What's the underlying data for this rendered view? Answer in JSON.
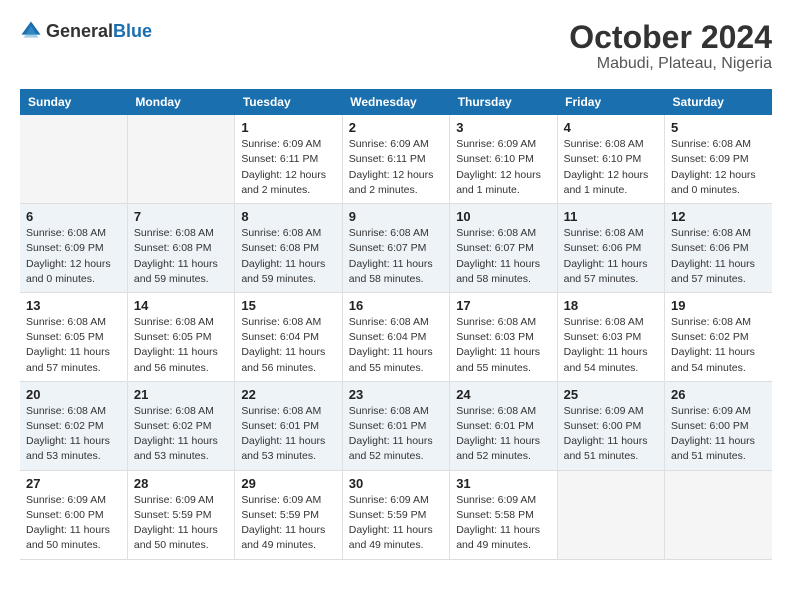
{
  "logo": {
    "general": "General",
    "blue": "Blue"
  },
  "title": "October 2024",
  "subtitle": "Mabudi, Plateau, Nigeria",
  "days_of_week": [
    "Sunday",
    "Monday",
    "Tuesday",
    "Wednesday",
    "Thursday",
    "Friday",
    "Saturday"
  ],
  "weeks": [
    [
      {
        "day": "",
        "info": ""
      },
      {
        "day": "",
        "info": ""
      },
      {
        "day": "1",
        "info": "Sunrise: 6:09 AM\nSunset: 6:11 PM\nDaylight: 12 hours\nand 2 minutes."
      },
      {
        "day": "2",
        "info": "Sunrise: 6:09 AM\nSunset: 6:11 PM\nDaylight: 12 hours\nand 2 minutes."
      },
      {
        "day": "3",
        "info": "Sunrise: 6:09 AM\nSunset: 6:10 PM\nDaylight: 12 hours\nand 1 minute."
      },
      {
        "day": "4",
        "info": "Sunrise: 6:08 AM\nSunset: 6:10 PM\nDaylight: 12 hours\nand 1 minute."
      },
      {
        "day": "5",
        "info": "Sunrise: 6:08 AM\nSunset: 6:09 PM\nDaylight: 12 hours\nand 0 minutes."
      }
    ],
    [
      {
        "day": "6",
        "info": "Sunrise: 6:08 AM\nSunset: 6:09 PM\nDaylight: 12 hours\nand 0 minutes."
      },
      {
        "day": "7",
        "info": "Sunrise: 6:08 AM\nSunset: 6:08 PM\nDaylight: 11 hours\nand 59 minutes."
      },
      {
        "day": "8",
        "info": "Sunrise: 6:08 AM\nSunset: 6:08 PM\nDaylight: 11 hours\nand 59 minutes."
      },
      {
        "day": "9",
        "info": "Sunrise: 6:08 AM\nSunset: 6:07 PM\nDaylight: 11 hours\nand 58 minutes."
      },
      {
        "day": "10",
        "info": "Sunrise: 6:08 AM\nSunset: 6:07 PM\nDaylight: 11 hours\nand 58 minutes."
      },
      {
        "day": "11",
        "info": "Sunrise: 6:08 AM\nSunset: 6:06 PM\nDaylight: 11 hours\nand 57 minutes."
      },
      {
        "day": "12",
        "info": "Sunrise: 6:08 AM\nSunset: 6:06 PM\nDaylight: 11 hours\nand 57 minutes."
      }
    ],
    [
      {
        "day": "13",
        "info": "Sunrise: 6:08 AM\nSunset: 6:05 PM\nDaylight: 11 hours\nand 57 minutes."
      },
      {
        "day": "14",
        "info": "Sunrise: 6:08 AM\nSunset: 6:05 PM\nDaylight: 11 hours\nand 56 minutes."
      },
      {
        "day": "15",
        "info": "Sunrise: 6:08 AM\nSunset: 6:04 PM\nDaylight: 11 hours\nand 56 minutes."
      },
      {
        "day": "16",
        "info": "Sunrise: 6:08 AM\nSunset: 6:04 PM\nDaylight: 11 hours\nand 55 minutes."
      },
      {
        "day": "17",
        "info": "Sunrise: 6:08 AM\nSunset: 6:03 PM\nDaylight: 11 hours\nand 55 minutes."
      },
      {
        "day": "18",
        "info": "Sunrise: 6:08 AM\nSunset: 6:03 PM\nDaylight: 11 hours\nand 54 minutes."
      },
      {
        "day": "19",
        "info": "Sunrise: 6:08 AM\nSunset: 6:02 PM\nDaylight: 11 hours\nand 54 minutes."
      }
    ],
    [
      {
        "day": "20",
        "info": "Sunrise: 6:08 AM\nSunset: 6:02 PM\nDaylight: 11 hours\nand 53 minutes."
      },
      {
        "day": "21",
        "info": "Sunrise: 6:08 AM\nSunset: 6:02 PM\nDaylight: 11 hours\nand 53 minutes."
      },
      {
        "day": "22",
        "info": "Sunrise: 6:08 AM\nSunset: 6:01 PM\nDaylight: 11 hours\nand 53 minutes."
      },
      {
        "day": "23",
        "info": "Sunrise: 6:08 AM\nSunset: 6:01 PM\nDaylight: 11 hours\nand 52 minutes."
      },
      {
        "day": "24",
        "info": "Sunrise: 6:08 AM\nSunset: 6:01 PM\nDaylight: 11 hours\nand 52 minutes."
      },
      {
        "day": "25",
        "info": "Sunrise: 6:09 AM\nSunset: 6:00 PM\nDaylight: 11 hours\nand 51 minutes."
      },
      {
        "day": "26",
        "info": "Sunrise: 6:09 AM\nSunset: 6:00 PM\nDaylight: 11 hours\nand 51 minutes."
      }
    ],
    [
      {
        "day": "27",
        "info": "Sunrise: 6:09 AM\nSunset: 6:00 PM\nDaylight: 11 hours\nand 50 minutes."
      },
      {
        "day": "28",
        "info": "Sunrise: 6:09 AM\nSunset: 5:59 PM\nDaylight: 11 hours\nand 50 minutes."
      },
      {
        "day": "29",
        "info": "Sunrise: 6:09 AM\nSunset: 5:59 PM\nDaylight: 11 hours\nand 49 minutes."
      },
      {
        "day": "30",
        "info": "Sunrise: 6:09 AM\nSunset: 5:59 PM\nDaylight: 11 hours\nand 49 minutes."
      },
      {
        "day": "31",
        "info": "Sunrise: 6:09 AM\nSunset: 5:58 PM\nDaylight: 11 hours\nand 49 minutes."
      },
      {
        "day": "",
        "info": ""
      },
      {
        "day": "",
        "info": ""
      }
    ]
  ]
}
